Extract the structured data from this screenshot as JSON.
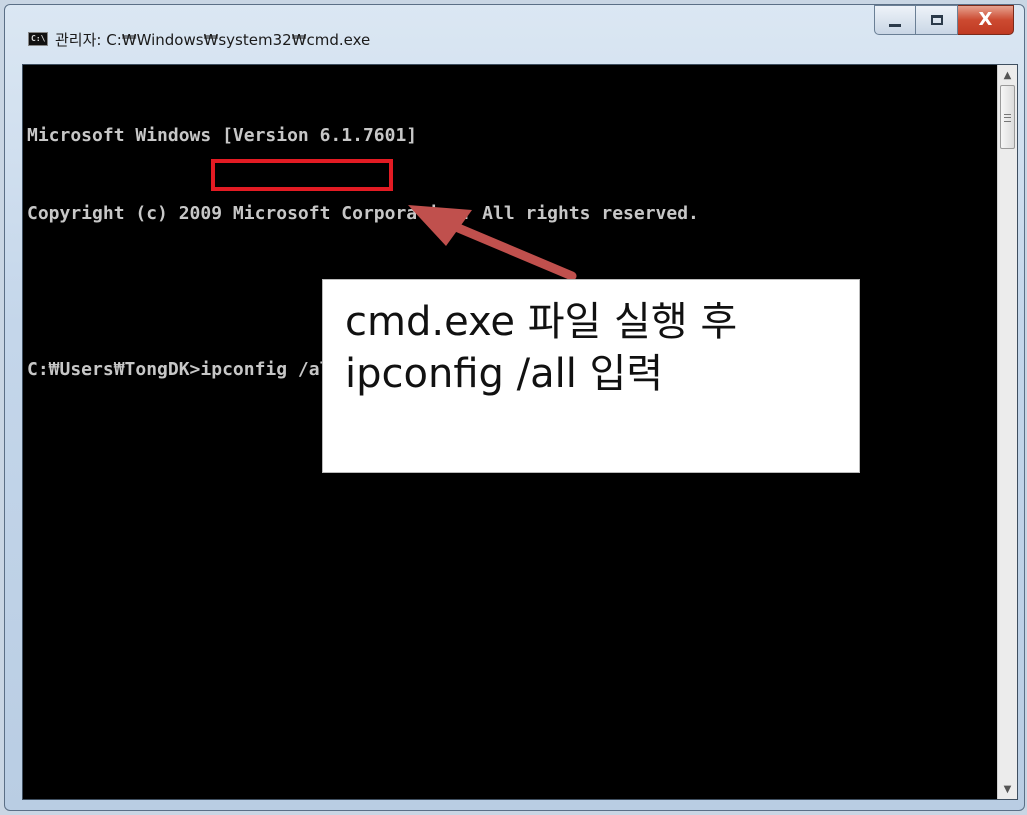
{
  "window": {
    "title": "관리자: C:₩Windows₩system32₩cmd.exe",
    "icon": "cmd-icon",
    "controls": {
      "minimize_icon": "minimize-icon",
      "maximize_icon": "maximize-icon",
      "close_label": "X"
    }
  },
  "console": {
    "lines": [
      "Microsoft Windows [Version 6.1.7601]",
      "Copyright (c) 2009 Microsoft Corporation. All rights reserved.",
      ""
    ],
    "prompt": "C:₩Users₩TongDK>",
    "command": "ipconfig /all",
    "text_color": "#c7c7c7",
    "background": "#000000"
  },
  "annotation": {
    "line1": "cmd.exe 파일 실행 후",
    "line2": "ipconfig /all 입력",
    "highlight_color": "#e31b23",
    "arrow_color": "#c0504d"
  }
}
